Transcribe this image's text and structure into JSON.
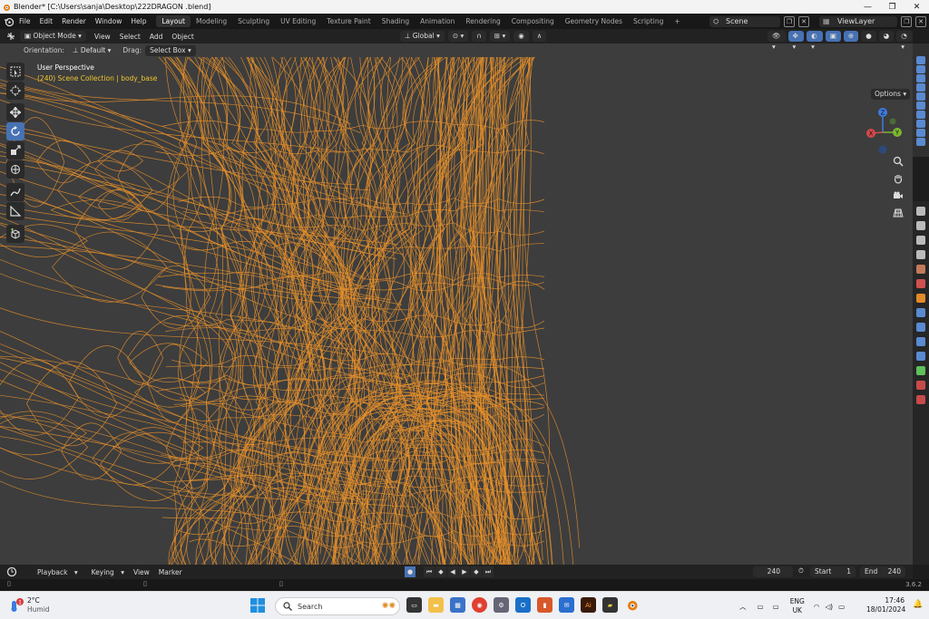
{
  "window": {
    "title": "Blender* [C:\\Users\\sanja\\Desktop\\222DRAGON .blend]"
  },
  "menu": [
    "File",
    "Edit",
    "Render",
    "Window",
    "Help"
  ],
  "workspaces": [
    "Layout",
    "Modeling",
    "Sculpting",
    "UV Editing",
    "Texture Paint",
    "Shading",
    "Animation",
    "Rendering",
    "Compositing",
    "Geometry Nodes",
    "Scripting",
    "+"
  ],
  "active_workspace": "Layout",
  "scene": {
    "name": "Scene"
  },
  "view_layer": {
    "name": "ViewLayer"
  },
  "header": {
    "mode": "Object Mode",
    "menus": [
      "View",
      "Select",
      "Add",
      "Object"
    ],
    "transform_orientation": "Global"
  },
  "tool_settings": {
    "orientation_label": "Orientation:",
    "orientation_value": "Default",
    "drag_label": "Drag:",
    "drag_value": "Select Box",
    "options_label": "Options"
  },
  "viewport": {
    "view_name": "User Perspective",
    "collection_info": "(240) Scene Collection | body_base",
    "wire_color": "#e8902a",
    "background": "#3d3d3d"
  },
  "gizmo": {
    "x": "X",
    "y": "Y",
    "z": "Z"
  },
  "timeline": {
    "menus": [
      "Playback",
      "Keying",
      "View",
      "Marker"
    ],
    "current_frame": "240",
    "start_label": "Start",
    "start_value": "1",
    "end_label": "End",
    "end_value": "240"
  },
  "status": {
    "version": "3.6.2"
  },
  "taskbar": {
    "weather_temp": "2°C",
    "weather_desc": "Humid",
    "notification_count": "1",
    "search_placeholder": "Search",
    "lang_top": "ENG",
    "lang_bottom": "UK",
    "time": "17:46",
    "date": "18/01/2024"
  }
}
